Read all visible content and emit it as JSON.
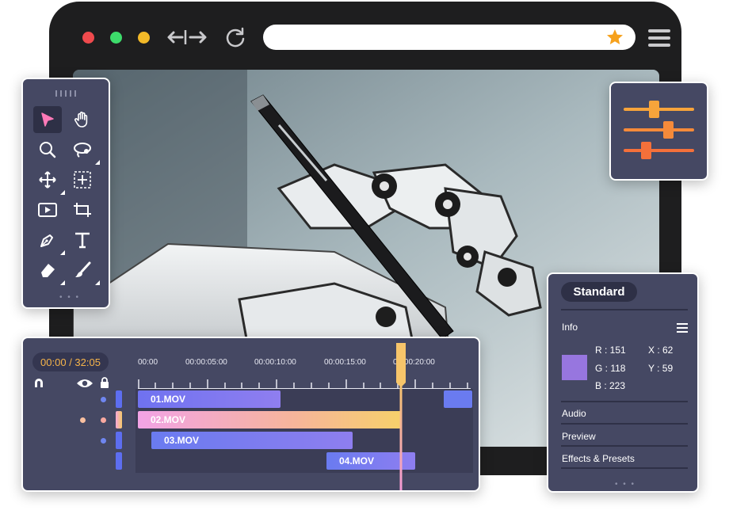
{
  "browser": {
    "url": "",
    "colors": {
      "close": "#ef4a4d",
      "minimize": "#3ddc6b",
      "maximize": "#f2b928",
      "star": "#f6a11c"
    }
  },
  "tools_panel": {
    "tools": [
      "pointer",
      "hand",
      "zoom",
      "lasso",
      "move",
      "transform",
      "video",
      "crop",
      "pen",
      "text",
      "eraser",
      "brush"
    ]
  },
  "timeline": {
    "time_display": "00:00 / 32:05",
    "ruler_labels": [
      "00:00",
      "00:00:05:00",
      "00:00:10:00",
      "00:00:15:00",
      "00:00:20:00"
    ],
    "clips": [
      {
        "label": "01.MOV"
      },
      {
        "label": "02.MOV"
      },
      {
        "label": "03.MOV"
      },
      {
        "label": "04.MOV"
      }
    ]
  },
  "properties": {
    "preset": "Standard",
    "info_label": "Info",
    "r": "R : 151",
    "g": "G : 118",
    "b": "B : 223",
    "x": "X : 62",
    "y": "Y : 59",
    "sections": [
      "Audio",
      "Preview",
      "Effects & Presets"
    ],
    "swatch_color": "#9776df"
  }
}
